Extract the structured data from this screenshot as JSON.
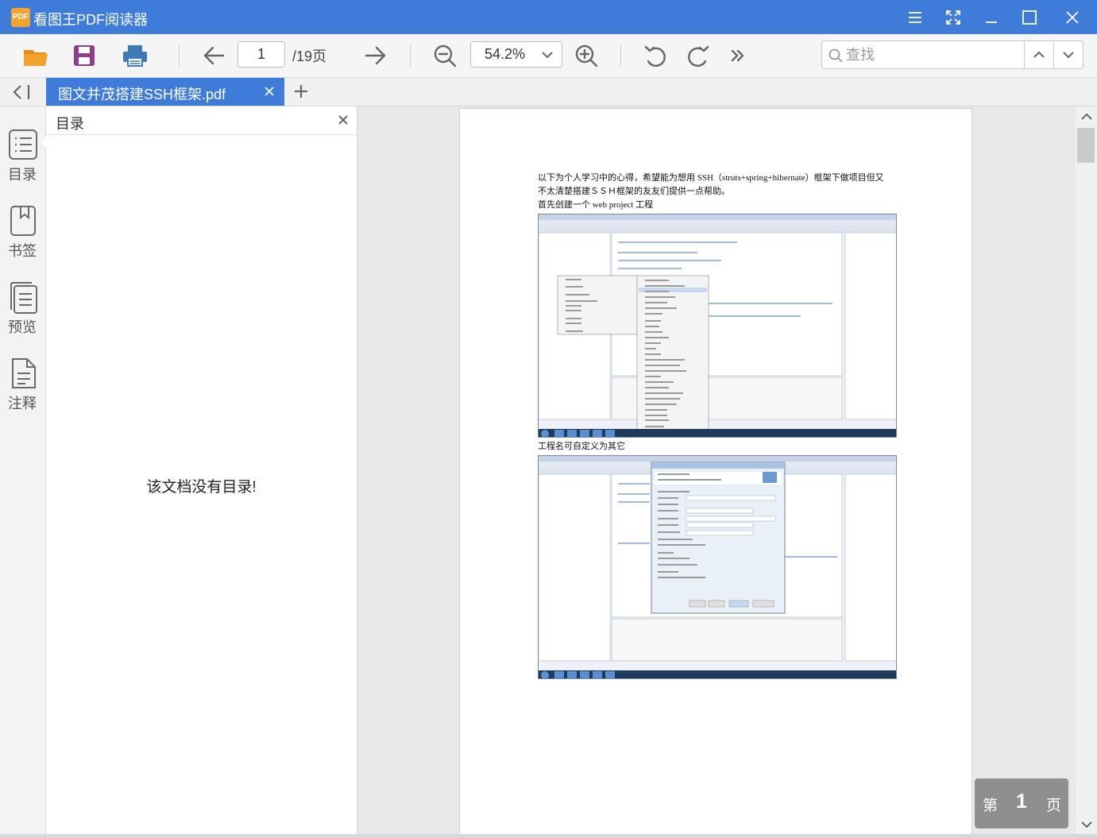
{
  "app": {
    "logo_text": "PDF",
    "title": "看图王PDF阅读器"
  },
  "toolbar": {
    "page_current": "1",
    "page_total": "/19页",
    "zoom": "54.2%",
    "search_placeholder": "查找"
  },
  "tabs": [
    {
      "label": "图文并茂搭建SSH框架.pdf",
      "active": true
    }
  ],
  "rail": {
    "items": [
      {
        "label": "目录",
        "icon": "list-icon",
        "active": true
      },
      {
        "label": "书签",
        "icon": "bookmark-icon"
      },
      {
        "label": "预览",
        "icon": "preview-icon"
      },
      {
        "label": "注释",
        "icon": "annotation-icon"
      }
    ]
  },
  "outline": {
    "title": "目录",
    "empty_message": "该文档没有目录!"
  },
  "document": {
    "line1": "以下为个人学习中的心得，希望能为想用 SSH（struts+spring+hibernate）框架下做项目但又",
    "line2": "不太清楚搭建ＳＳＨ框架的友友们提供一点帮助。",
    "line3": "首先创建一个 web project 工程",
    "caption2": "工程名可自定义为其它"
  },
  "page_badge": {
    "prefix": "第",
    "number": "1",
    "suffix": "页"
  },
  "colors": {
    "accent": "#3f7bd9",
    "folder_icon": "#f2a12b",
    "save_icon": "#8e3e8c",
    "print_icon": "#3d7ab8"
  }
}
